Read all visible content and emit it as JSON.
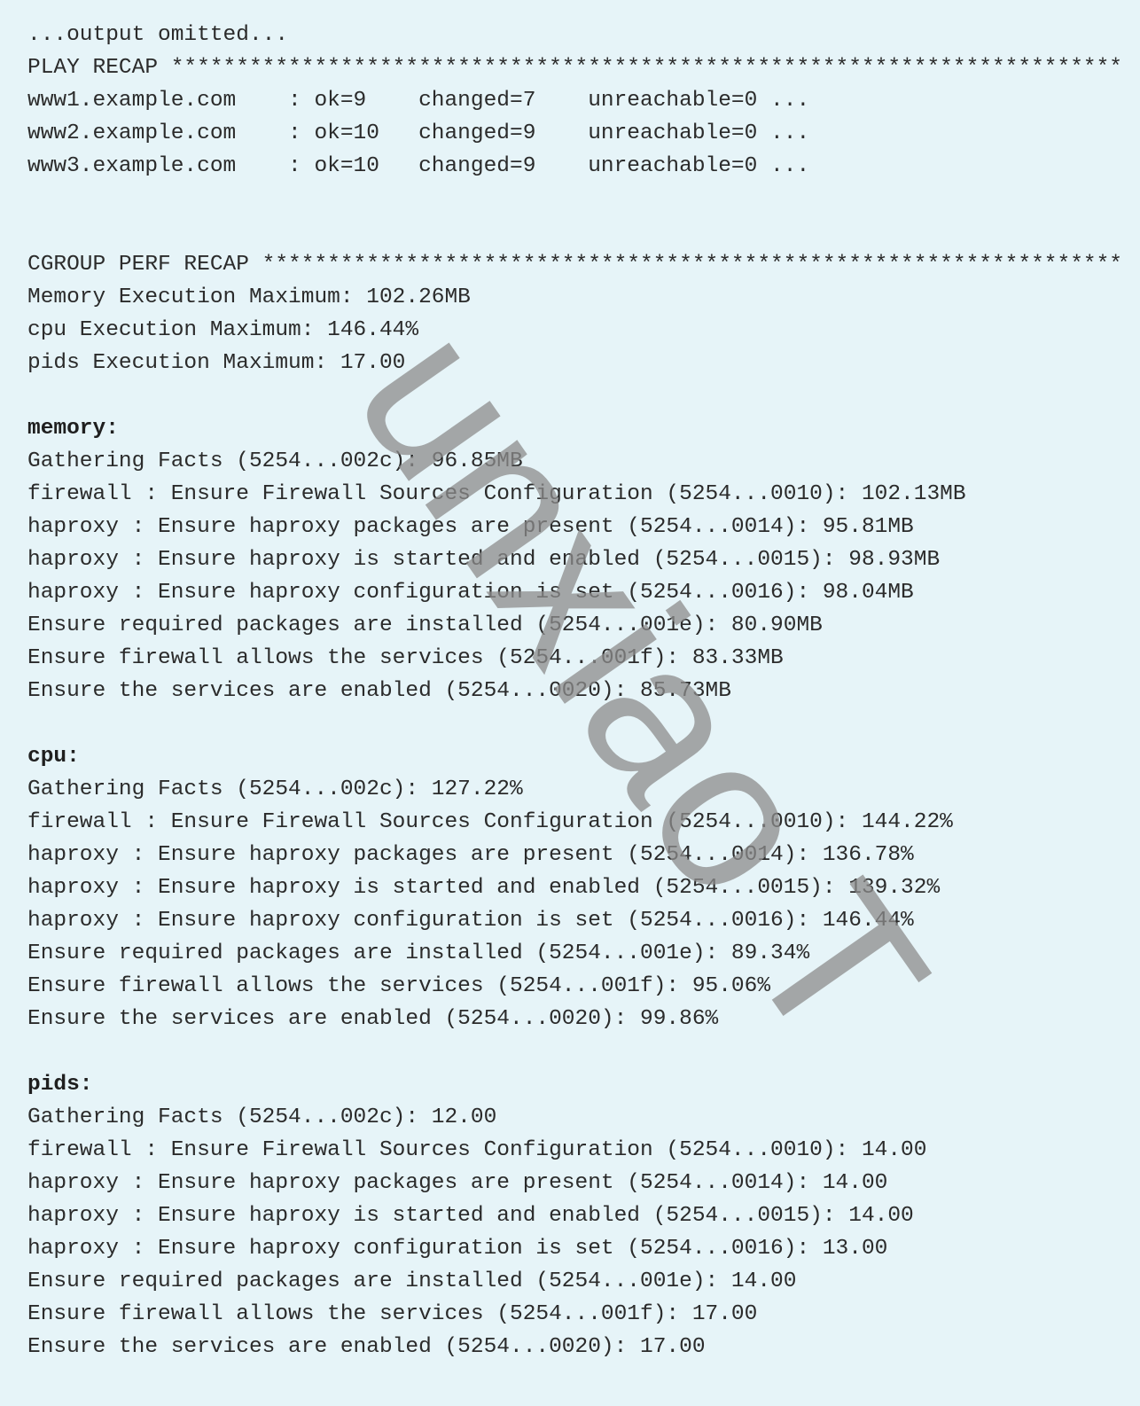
{
  "terminal": {
    "lines": [
      {
        "text": "...output omitted...",
        "kind": "normal"
      },
      {
        "text": "PLAY RECAP *************************************************************************",
        "kind": "normal"
      },
      {
        "text": "www1.example.com    : ok=9    changed=7    unreachable=0 ...",
        "kind": "normal"
      },
      {
        "text": "www2.example.com    : ok=10   changed=9    unreachable=0 ...",
        "kind": "normal"
      },
      {
        "text": "www3.example.com    : ok=10   changed=9    unreachable=0 ...",
        "kind": "normal"
      },
      {
        "text": "",
        "kind": "blank"
      },
      {
        "text": "",
        "kind": "blank"
      },
      {
        "text": "CGROUP PERF RECAP ******************************************************************",
        "kind": "normal"
      },
      {
        "text": "Memory Execution Maximum: 102.26MB",
        "kind": "normal"
      },
      {
        "text": "cpu Execution Maximum: 146.44%",
        "kind": "normal"
      },
      {
        "text": "pids Execution Maximum: 17.00",
        "kind": "normal"
      },
      {
        "text": "",
        "kind": "blank"
      },
      {
        "text": "memory:",
        "kind": "heading"
      },
      {
        "text": "Gathering Facts (5254...002c): 96.85MB",
        "kind": "normal"
      },
      {
        "text": "firewall : Ensure Firewall Sources Configuration (5254...0010): 102.13MB",
        "kind": "normal"
      },
      {
        "text": "haproxy : Ensure haproxy packages are present (5254...0014): 95.81MB",
        "kind": "normal"
      },
      {
        "text": "haproxy : Ensure haproxy is started and enabled (5254...0015): 98.93MB",
        "kind": "normal"
      },
      {
        "text": "haproxy : Ensure haproxy configuration is set (5254...0016): 98.04MB",
        "kind": "normal"
      },
      {
        "text": "Ensure required packages are installed (5254...001e): 80.90MB",
        "kind": "normal"
      },
      {
        "text": "Ensure firewall allows the services (5254...001f): 83.33MB",
        "kind": "normal"
      },
      {
        "text": "Ensure the services are enabled (5254...0020): 85.73MB",
        "kind": "normal"
      },
      {
        "text": "",
        "kind": "blank"
      },
      {
        "text": "cpu:",
        "kind": "heading"
      },
      {
        "text": "Gathering Facts (5254...002c): 127.22%",
        "kind": "normal"
      },
      {
        "text": "firewall : Ensure Firewall Sources Configuration (5254...0010): 144.22%",
        "kind": "normal"
      },
      {
        "text": "haproxy : Ensure haproxy packages are present (5254...0014): 136.78%",
        "kind": "normal"
      },
      {
        "text": "haproxy : Ensure haproxy is started and enabled (5254...0015): 139.32%",
        "kind": "normal"
      },
      {
        "text": "haproxy : Ensure haproxy configuration is set (5254...0016): 146.44%",
        "kind": "normal"
      },
      {
        "text": "Ensure required packages are installed (5254...001e): 89.34%",
        "kind": "normal"
      },
      {
        "text": "Ensure firewall allows the services (5254...001f): 95.06%",
        "kind": "normal"
      },
      {
        "text": "Ensure the services are enabled (5254...0020): 99.86%",
        "kind": "normal"
      },
      {
        "text": "",
        "kind": "blank"
      },
      {
        "text": "pids:",
        "kind": "heading"
      },
      {
        "text": "Gathering Facts (5254...002c): 12.00",
        "kind": "normal"
      },
      {
        "text": "firewall : Ensure Firewall Sources Configuration (5254...0010): 14.00",
        "kind": "normal"
      },
      {
        "text": "haproxy : Ensure haproxy packages are present (5254...0014): 14.00",
        "kind": "normal"
      },
      {
        "text": "haproxy : Ensure haproxy is started and enabled (5254...0015): 14.00",
        "kind": "normal"
      },
      {
        "text": "haproxy : Ensure haproxy configuration is set (5254...0016): 13.00",
        "kind": "normal"
      },
      {
        "text": "Ensure required packages are installed (5254...001e): 14.00",
        "kind": "normal"
      },
      {
        "text": "Ensure firewall allows the services (5254...001f): 17.00",
        "kind": "normal"
      },
      {
        "text": "Ensure the services are enabled (5254...0020): 17.00",
        "kind": "normal"
      }
    ]
  },
  "watermark": {
    "text": "unxiao T",
    "color": "#8c8c8c"
  },
  "colors": {
    "background": "#e6f4f8",
    "text": "#2b2b2b"
  }
}
